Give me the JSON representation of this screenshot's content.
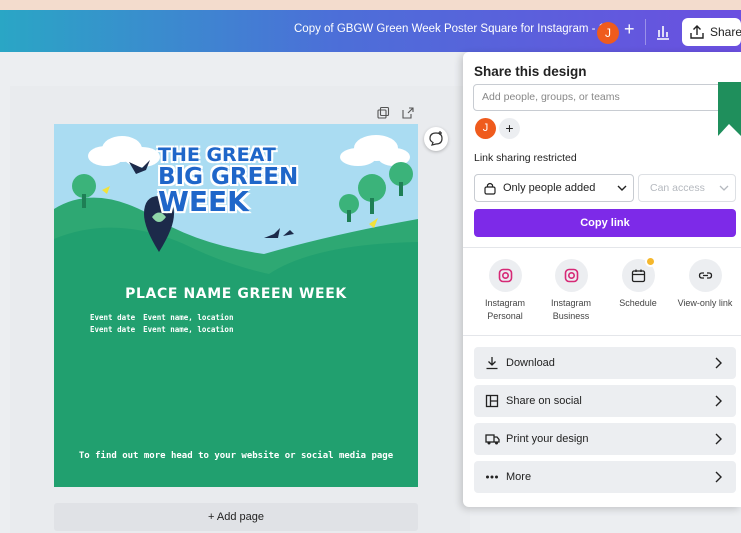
{
  "topbar": {
    "document_title": "Copy of GBGW Green Week Poster Square for Instagram - 1..",
    "avatar_initial": "J",
    "add_label": "+",
    "share_label": "Share"
  },
  "poster": {
    "logo_line1": "THE GREAT",
    "logo_line2": "BIG GREEN",
    "logo_line3": "WEEK",
    "title": "PLACE NAME GREEN WEEK",
    "rows": [
      {
        "label": "Event date",
        "value": "Event name, location"
      },
      {
        "label": "Event date",
        "value": "Event name, location"
      }
    ],
    "footer": "To find out more head to your website or social media page",
    "colors": {
      "background": "#21a06f",
      "sky": "#aadcf2",
      "logo": "#1f66c9"
    }
  },
  "canvas": {
    "add_page_label": "+ Add page"
  },
  "share_panel": {
    "title": "Share this design",
    "input_placeholder": "Add people, groups, or teams",
    "avatar_initial": "J",
    "add_label": "+",
    "link_sharing_label": "Link sharing restricted",
    "access_select_value": "Only people added",
    "permission_select_value": "Can access",
    "copy_link_label": "Copy link",
    "share_options": [
      {
        "icon": "instagram-icon",
        "line1": "Instagram",
        "line2": "Personal"
      },
      {
        "icon": "instagram-icon",
        "line1": "Instagram",
        "line2": "Business"
      },
      {
        "icon": "calendar-icon",
        "line1": "Schedule",
        "line2": ""
      },
      {
        "icon": "link-icon",
        "line1": "View-only link",
        "line2": ""
      }
    ],
    "actions": [
      {
        "icon": "download-icon",
        "label": "Download"
      },
      {
        "icon": "share-social-icon",
        "label": "Share on social"
      },
      {
        "icon": "truck-icon",
        "label": "Print your design"
      },
      {
        "icon": "more-icon",
        "label": "More"
      }
    ],
    "accent_color": "#7d2ae8"
  }
}
